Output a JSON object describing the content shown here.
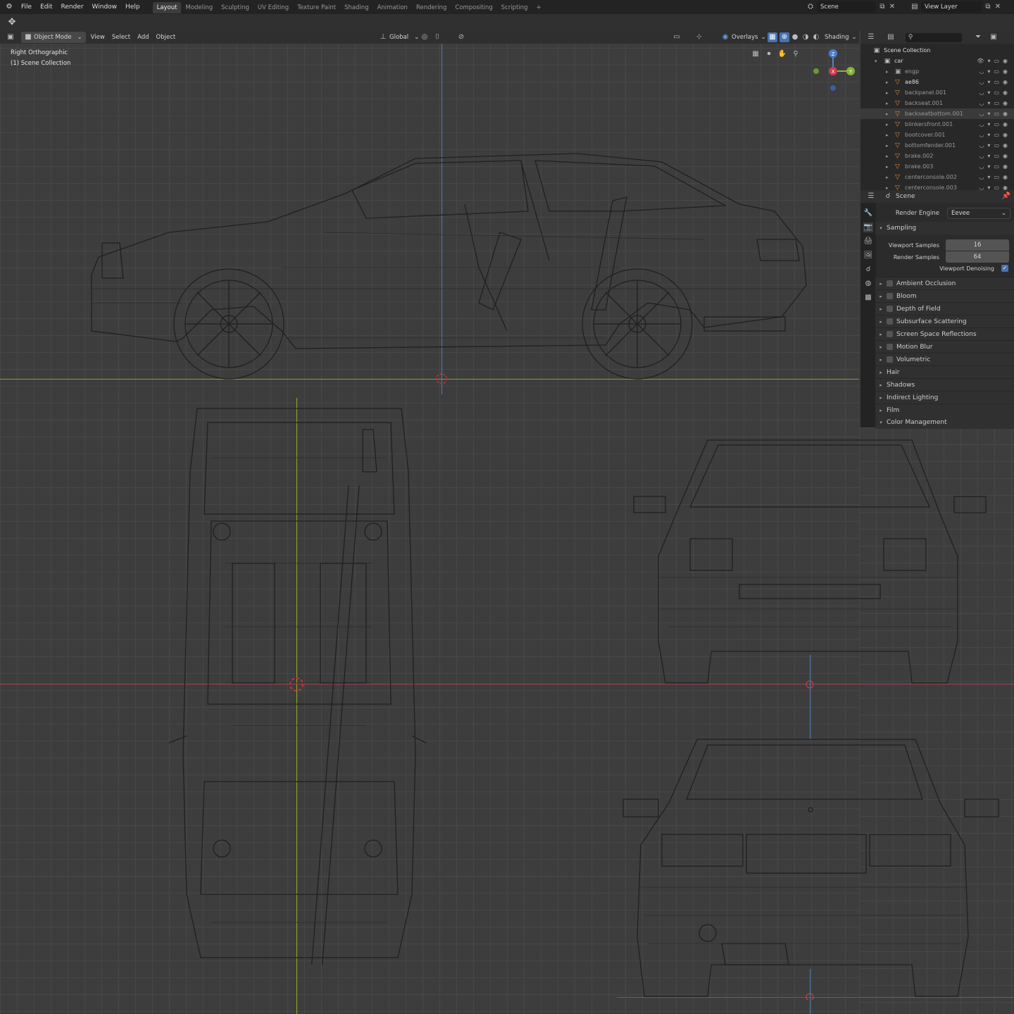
{
  "menu": [
    "File",
    "Edit",
    "Render",
    "Window",
    "Help"
  ],
  "workspaces": [
    {
      "label": "Layout",
      "active": true
    },
    {
      "label": "Modeling"
    },
    {
      "label": "Sculpting"
    },
    {
      "label": "UV Editing"
    },
    {
      "label": "Texture Paint"
    },
    {
      "label": "Shading"
    },
    {
      "label": "Animation"
    },
    {
      "label": "Rendering"
    },
    {
      "label": "Compositing"
    },
    {
      "label": "Scripting"
    }
  ],
  "top_right": {
    "scene": "Scene",
    "view_layer": "View Layer"
  },
  "viewport_header": {
    "mode": "Object Mode",
    "menus": [
      "View",
      "Select",
      "Add",
      "Object"
    ],
    "orientation": "Global",
    "overlays": "Overlays",
    "shading": "Shading"
  },
  "viewport": {
    "view_name": "Right Orthographic",
    "collection": "(1) Scene Collection"
  },
  "gizmo": {
    "z": "Z",
    "x": "X",
    "y": "Y"
  },
  "outliner": {
    "root": "Scene Collection",
    "collection": "car",
    "items": [
      "engp",
      "ae86",
      "backpanel.001",
      "backseat.001",
      "backseatbottom.001",
      "blinkersfront.001",
      "bootcover.001",
      "bottomfender.001",
      "brake.002",
      "brake.003",
      "centerconsole.002",
      "centerconsole.003"
    ]
  },
  "properties": {
    "context": "Scene",
    "render_engine_label": "Render Engine",
    "render_engine": "Eevee",
    "sampling": "Sampling",
    "viewport_samples_label": "Viewport Samples",
    "viewport_samples": "16",
    "render_samples_label": "Render Samples",
    "render_samples": "64",
    "denoise_label": "Viewport Denoising",
    "toggle_panels": [
      "Ambient Occlusion",
      "Bloom",
      "Depth of Field",
      "Subsurface Scattering",
      "Screen Space Reflections",
      "Motion Blur",
      "Volumetric"
    ],
    "panels": [
      "Hair",
      "Shadows",
      "Indirect Lighting",
      "Film"
    ],
    "last_panel": "Color Management"
  }
}
